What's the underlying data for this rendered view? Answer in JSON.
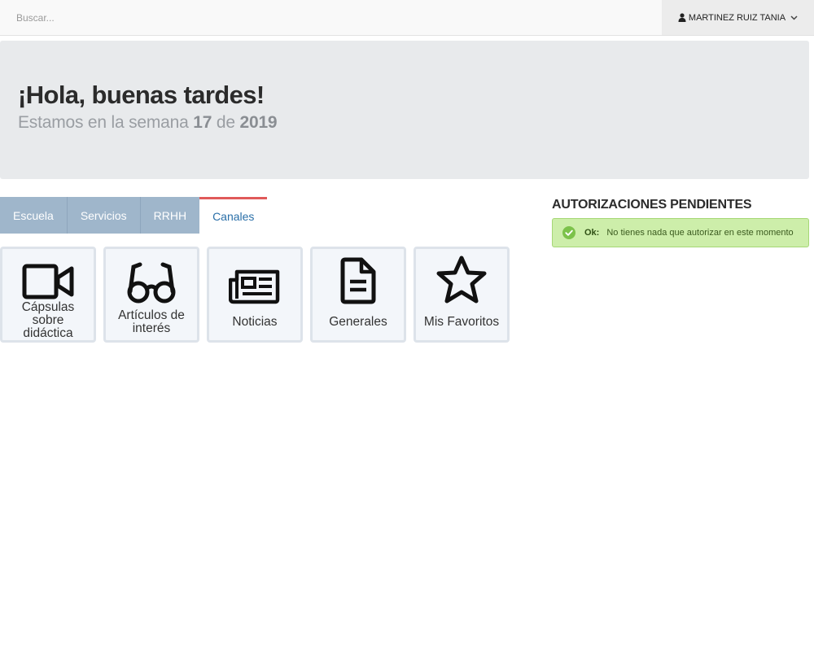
{
  "header": {
    "search_placeholder": "Buscar...",
    "user_name": "MARTINEZ RUIZ TANIA"
  },
  "hero": {
    "greeting": "¡Hola, buenas tardes!",
    "week_prefix": "Estamos en la semana",
    "week_number": "17",
    "week_connector": "de",
    "year": "2019"
  },
  "tabs": [
    {
      "label": "Escuela"
    },
    {
      "label": "Servicios"
    },
    {
      "label": "RRHH"
    },
    {
      "label": "Canales",
      "active": true
    }
  ],
  "channels": [
    {
      "label": "Cápsulas sobre didáctica",
      "icon": "video-camera-icon"
    },
    {
      "label": "Artículos de interés",
      "icon": "glasses-icon"
    },
    {
      "label": "Noticias",
      "icon": "newspaper-icon"
    },
    {
      "label": "Generales",
      "icon": "document-icon"
    },
    {
      "label": "Mis Favoritos",
      "icon": "star-icon"
    }
  ],
  "authorizations": {
    "title": "AUTORIZACIONES PENDIENTES",
    "status_label": "Ok:",
    "status_message": "No tienes nada que autorizar en este momento"
  },
  "colors": {
    "accent_red": "#e05a5a",
    "tab_blue": "#9fb6cb",
    "link_blue": "#2a6fa8",
    "success_green": "#cdeeaa"
  }
}
